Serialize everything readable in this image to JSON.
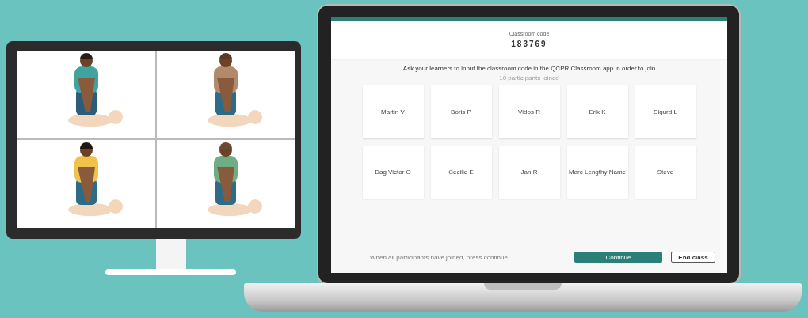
{
  "classroom": {
    "code_label": "Classroom code",
    "code": "183769"
  },
  "instruction": "Ask your learners to input the classroom code in the QCPR Classroom app in order to join",
  "participant_count": "10 participants joined",
  "participants": [
    {
      "name": "Martin V"
    },
    {
      "name": "Boris P"
    },
    {
      "name": "Vidos R"
    },
    {
      "name": "Erik K"
    },
    {
      "name": "Sigurd L"
    },
    {
      "name": "Dag Victor O"
    },
    {
      "name": "Cecilie E"
    },
    {
      "name": "Jan R"
    },
    {
      "name": "Marc Lengthy Name"
    },
    {
      "name": "Steve"
    }
  ],
  "footer": {
    "hint": "When all participants have joined, press continue.",
    "buttons": [
      {
        "label": "Continue",
        "kind": "primary"
      },
      {
        "label": "End class",
        "kind": "secondary"
      }
    ]
  }
}
